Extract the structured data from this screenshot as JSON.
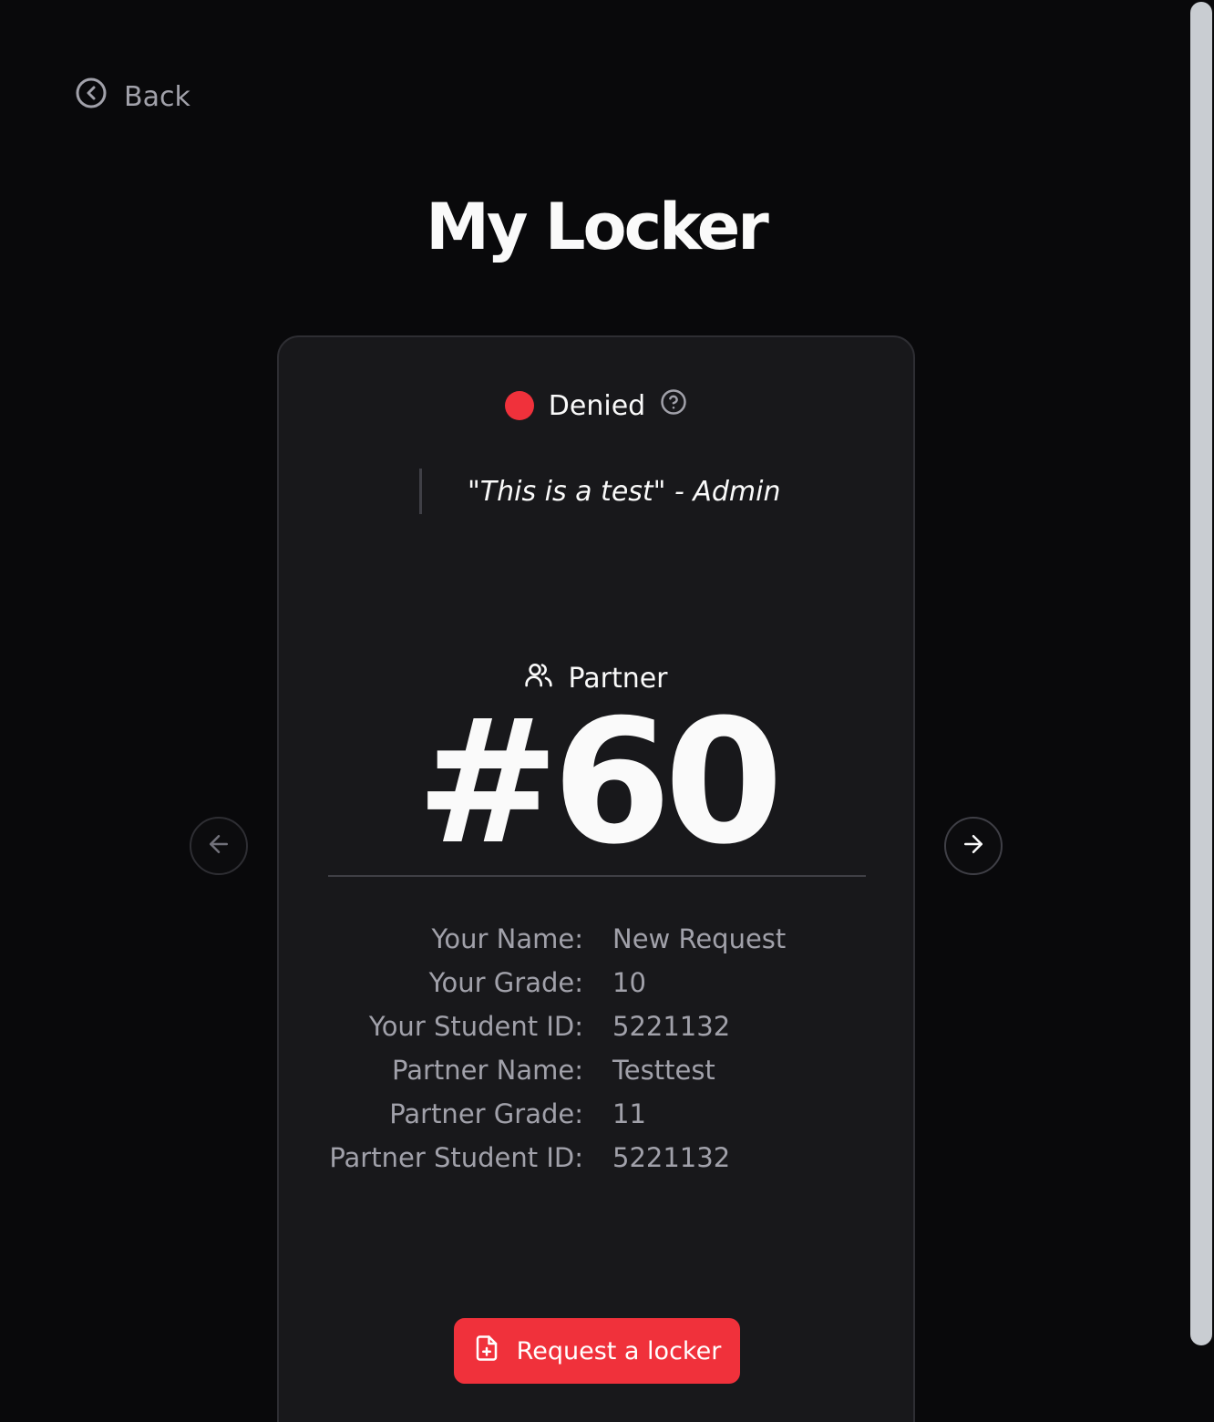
{
  "nav": {
    "back_label": "Back"
  },
  "page": {
    "title": "My Locker"
  },
  "locker": {
    "status": "Denied",
    "status_color": "#f0313b",
    "admin_note": "\"This is a test\" - Admin",
    "type": "Partner",
    "number": "#60",
    "details": [
      {
        "label": "Your Name:",
        "value": "New Request"
      },
      {
        "label": "Your Grade:",
        "value": "10"
      },
      {
        "label": "Your Student ID:",
        "value": "5221132"
      },
      {
        "label": "Partner Name:",
        "value": "Testtest"
      },
      {
        "label": "Partner Grade:",
        "value": "11"
      },
      {
        "label": "Partner Student ID:",
        "value": "5221132"
      }
    ]
  },
  "actions": {
    "request_label": "Request a locker"
  },
  "icons": {
    "back": "circle-chevron-left-icon",
    "help": "circle-question-icon",
    "partner": "users-icon",
    "request": "file-plus-icon",
    "prev": "arrow-left-icon",
    "next": "arrow-right-icon"
  }
}
